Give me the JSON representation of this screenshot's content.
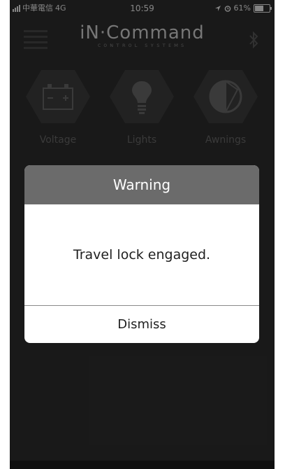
{
  "status_bar": {
    "carrier": "中華電信",
    "network": "4G",
    "time": "10:59",
    "battery": "61%",
    "icons": [
      "signal-bars-icon",
      "location-arrow-icon",
      "alarm-icon",
      "battery-icon"
    ]
  },
  "header": {
    "brand_name": "iN·Command",
    "brand_subtitle": "ᴄᴏɴᴛʀᴏʟ sʏsᴛᴇᴍs",
    "icons": [
      "menu-icon",
      "bluetooth-icon"
    ]
  },
  "tiles": [
    {
      "label": "Voltage",
      "icon": "battery-icon"
    },
    {
      "label": "Lights",
      "icon": "light-bulb-icon"
    },
    {
      "label": "Awnings",
      "icon": "awning-icon"
    }
  ],
  "dialog": {
    "title": "Warning",
    "message": "Travel lock engaged.",
    "button_label": "Dismiss"
  },
  "colors": {
    "app_background": "#2f2f2f",
    "dialog_header": "#6b6b6b",
    "dialog_background": "#ffffff"
  }
}
